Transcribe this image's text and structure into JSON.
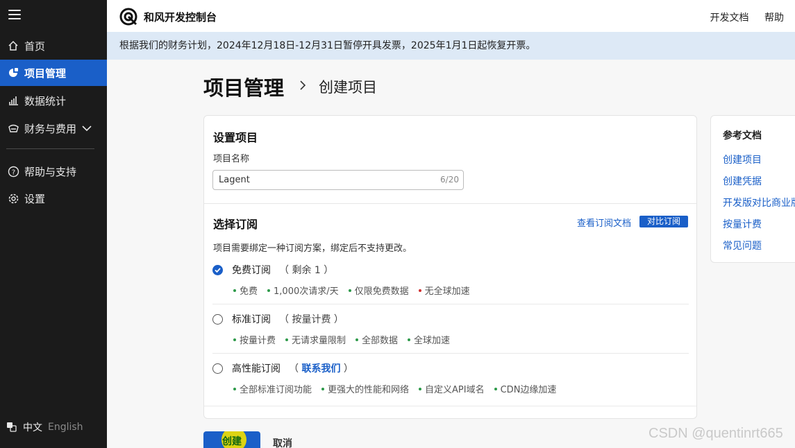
{
  "sidebar": {
    "items": [
      {
        "label": "首页",
        "icon": "home-icon"
      },
      {
        "label": "项目管理",
        "icon": "project-icon"
      },
      {
        "label": "数据统计",
        "icon": "chart-icon"
      },
      {
        "label": "财务与费用",
        "icon": "wallet-icon"
      },
      {
        "label": "帮助与支持",
        "icon": "help-icon"
      },
      {
        "label": "设置",
        "icon": "gear-icon"
      }
    ],
    "lang_zh": "中文",
    "lang_en": "English"
  },
  "header": {
    "brand": "和风开发控制台",
    "links": [
      "开发文档",
      "帮助"
    ]
  },
  "notice": "根据我们的财务计划，2024年12月18日-12月31日暂停开具发票，2025年1月1日起恢复开票。",
  "page": {
    "title": "项目管理",
    "subtitle": "创建项目"
  },
  "setup": {
    "title": "设置项目",
    "name_label": "项目名称",
    "name_value": "Lagent",
    "name_count": "6/20"
  },
  "subscription": {
    "title": "选择订阅",
    "view_docs": "查看订阅文档",
    "compare": "对比订阅",
    "desc": "项目需要绑定一种订阅方案，绑定后不支持更改。",
    "plans": [
      {
        "name": "免费订阅",
        "paren_open": "（",
        "note": "剩余 1",
        "paren_close": "）",
        "checked": true,
        "features": [
          "免费",
          "1,000次请求/天",
          "仅限免费数据",
          "无全球加速"
        ]
      },
      {
        "name": "标准订阅",
        "paren_open": "（",
        "note": "按量计费",
        "paren_close": "）",
        "checked": false,
        "features": [
          "按量计费",
          "无请求量限制",
          "全部数据",
          "全球加速"
        ]
      },
      {
        "name": "高性能订阅",
        "paren_open": "（",
        "note": "联系我们",
        "paren_close": "）",
        "checked": false,
        "features": [
          "全部标准订阅功能",
          "更强大的性能和网络",
          "自定义API域名",
          "CDN边缘加速"
        ]
      }
    ]
  },
  "reference": {
    "title": "参考文档",
    "links": [
      "创建项目",
      "创建凭据",
      "开发版对比商业版",
      "按量计费",
      "常见问题"
    ]
  },
  "actions": {
    "create": "创建",
    "cancel": "取消"
  },
  "watermark": "CSDN @quentinrt665",
  "colors": {
    "accent": "#1a5fc8",
    "sidebar_bg": "#1b1b1b",
    "notice_bg": "#dde9f6"
  }
}
